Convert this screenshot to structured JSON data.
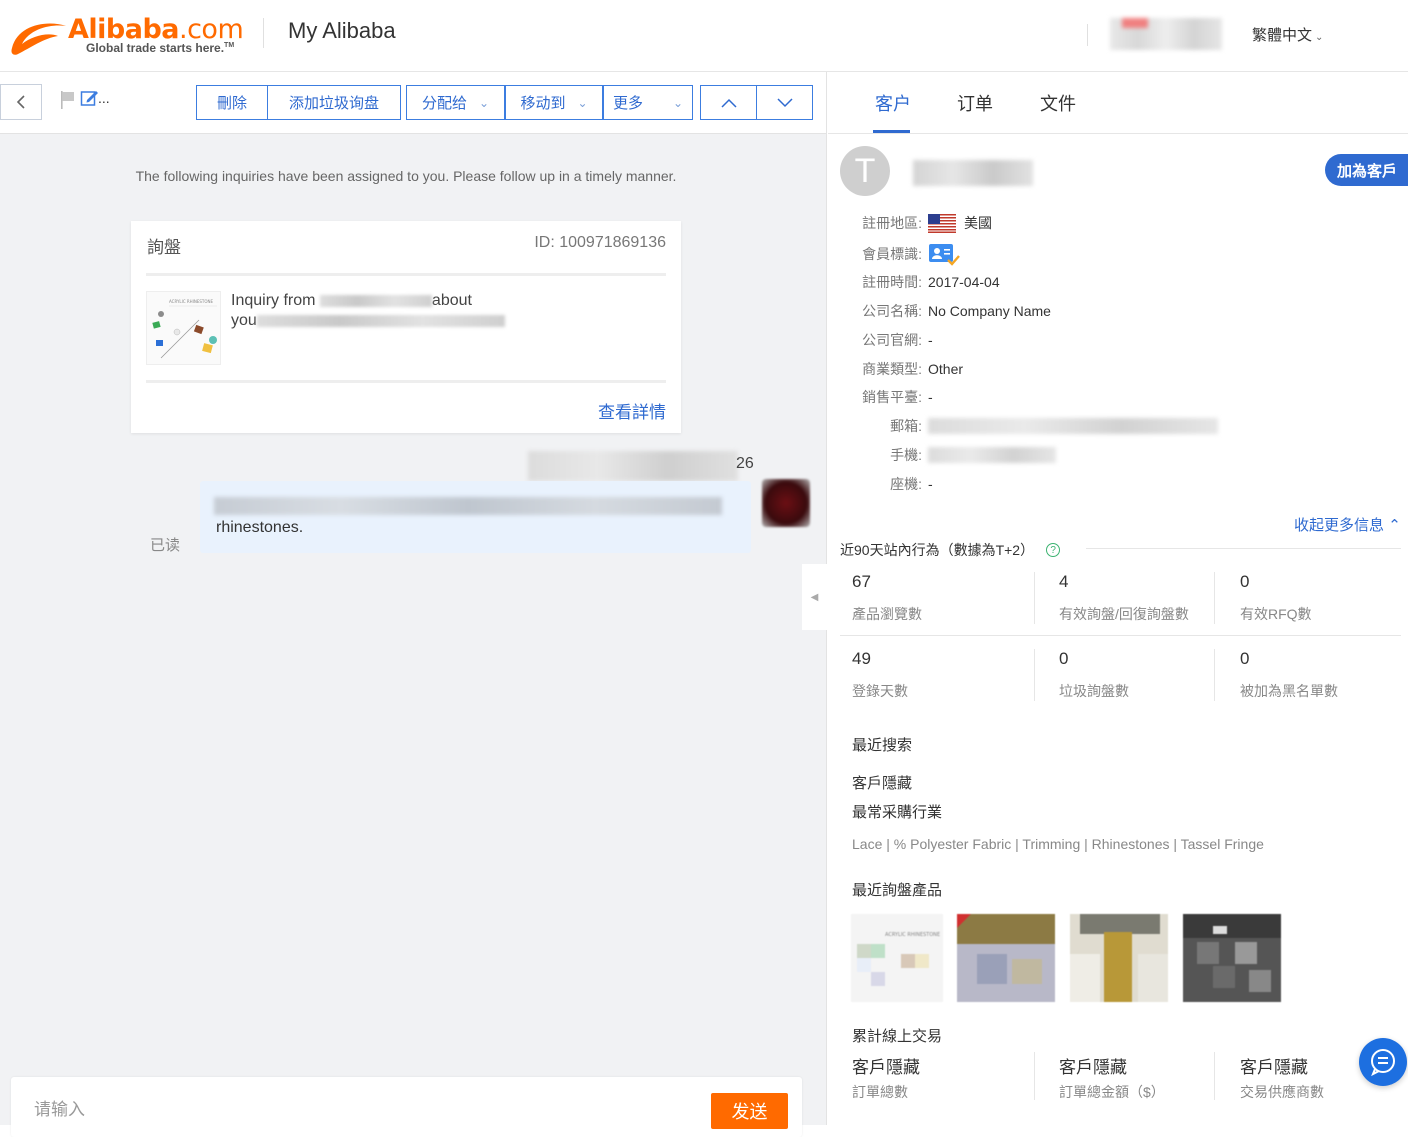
{
  "header": {
    "logo_word": "Alibaba",
    "logo_suffix": ".com",
    "logo_tagline": "Global trade starts here.",
    "logo_tm": "TM",
    "title": "My Alibaba",
    "language": "繁體中文"
  },
  "toolbar": {
    "delete": "刪除",
    "add_spam": "添加垃圾询盘",
    "assign": "分配给",
    "move_to": "移动到",
    "more": "更多",
    "ellipsis": "..."
  },
  "conversation": {
    "notice": "The following inquiries have been assigned to you. Please follow up in a timely manner.",
    "inquiry_card": {
      "title": "詢盤",
      "id_label": "ID:",
      "id_value": "100971869136",
      "line1_start": "Inquiry from",
      "line1_end": "about",
      "line2_start": "you",
      "view_details": "查看詳情"
    },
    "message_time_suffix": "26",
    "message_text": "rhinestones.",
    "read_status": "已读"
  },
  "composer": {
    "placeholder": "请输入",
    "send_label": "发送"
  },
  "right_panel": {
    "tabs": [
      {
        "label": "客户",
        "active": true
      },
      {
        "label": "订单",
        "active": false
      },
      {
        "label": "文件",
        "active": false
      }
    ],
    "customer_initial": "T",
    "add_customer": "加為客戶",
    "fields": {
      "region_label": "註冊地區:",
      "region_value": "美國",
      "member_label": "會員標識:",
      "reg_time_label": "註冊時間:",
      "reg_time_value": "2017-04-04",
      "company_label": "公司名稱:",
      "company_value": "No Company Name",
      "website_label": "公司官網:",
      "website_value": "-",
      "biz_type_label": "商業類型:",
      "biz_type_value": "Other",
      "platform_label": "銷售平臺:",
      "platform_value": "-",
      "email_label": "郵箱:",
      "mobile_label": "手機:",
      "phone_label": "座機:",
      "phone_value": "-"
    },
    "collapse_more": "收起更多信息",
    "activity_title": "近90天站內行為（數據為T+2）",
    "stats": [
      {
        "value": "67",
        "label": "產品瀏覽數"
      },
      {
        "value": "4",
        "label": "有效詢盤/回復詢盤數"
      },
      {
        "value": "0",
        "label": "有效RFQ數"
      },
      {
        "value": "49",
        "label": "登錄天數"
      },
      {
        "value": "0",
        "label": "垃圾詢盤數"
      },
      {
        "value": "0",
        "label": "被加為黑名單數"
      }
    ],
    "recent_search_title": "最近搜索",
    "recent_search_value": "客戶隱藏",
    "common_industry_title": "最常采購行業",
    "industries": "Lace | % Polyester Fabric | Trimming | Rhinestones | Tassel Fringe",
    "recent_products_title": "最近詢盤產品",
    "thumb_caption": "ACRYLIC RHINESTONE",
    "cumulative_title": "累計線上交易",
    "cumulative": [
      {
        "value": "客戶隱藏",
        "label": "訂單總數"
      },
      {
        "value": "客戶隱藏",
        "label": "訂單總金額（$）"
      },
      {
        "value": "客戶隱藏",
        "label": "交易供應商數"
      }
    ]
  },
  "colors": {
    "brand_orange": "#ff6a00",
    "link_blue": "#2f6ad0",
    "bubble_bg": "#e9f2fd"
  }
}
